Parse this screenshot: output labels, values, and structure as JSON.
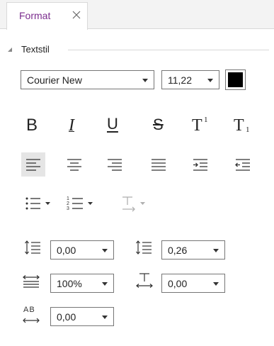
{
  "tab": {
    "label": "Format"
  },
  "section": {
    "title": "Textstil"
  },
  "font": {
    "family_value": "Courier New",
    "size_value": "11,22",
    "color": "#000000"
  },
  "style_buttons": {
    "bold": "B",
    "italic": "I",
    "underline": "U",
    "strike": "S",
    "superscript_base": "T",
    "superscript_mark": "1",
    "subscript_base": "T",
    "subscript_mark": "1"
  },
  "alignment": {
    "selected": "align-left"
  },
  "spacing": {
    "before_value": "0,00",
    "after_value": "0,26",
    "scale_value": "100%",
    "baseline_value": "0,00",
    "char_spacing_label": "AB",
    "char_spacing_value": "0,00"
  },
  "accent_color": "#7b2d8e"
}
